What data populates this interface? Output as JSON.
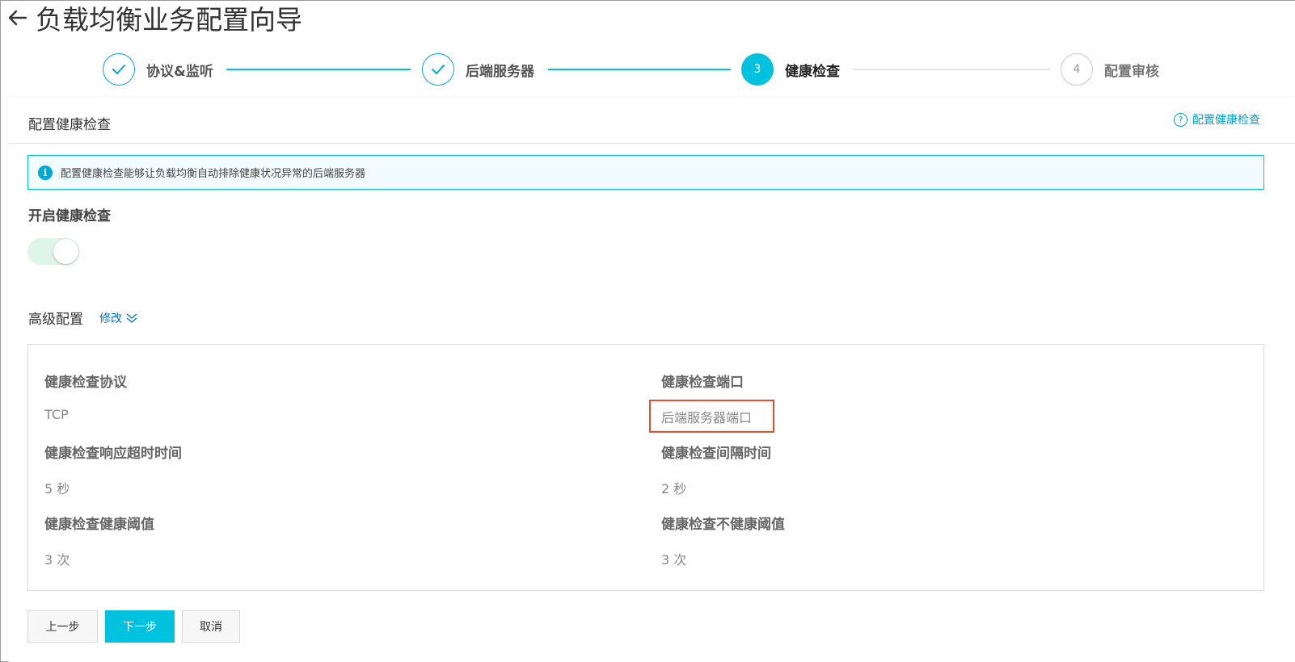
{
  "header": {
    "back_icon": "arrow-left-icon",
    "title": "负载均衡业务配置向导"
  },
  "steps": [
    {
      "label": "协议&监听",
      "status": "done",
      "marker": "✓"
    },
    {
      "label": "后端服务器",
      "status": "done",
      "marker": "✓"
    },
    {
      "label": "健康检查",
      "status": "active",
      "marker": "3"
    },
    {
      "label": "配置审核",
      "status": "todo",
      "marker": "4"
    }
  ],
  "card": {
    "title": "配置健康检查",
    "help_label": "配置健康检查",
    "help_icon": "question-circle-icon",
    "info_icon": "info-circle-icon",
    "info_text": "配置健康检查能够让负载均衡自动排除健康状况异常的后端服务器",
    "enable_label": "开启健康检查",
    "enable_on": true,
    "advanced_label": "高级配置",
    "modify_label": "修改"
  },
  "advanced": {
    "protocol_label": "健康检查协议",
    "protocol_value": "TCP",
    "port_label": "健康检查端口",
    "port_value": "后端服务器端口",
    "timeout_label": "健康检查响应超时时间",
    "timeout_value": "5 秒",
    "interval_label": "健康检查间隔时间",
    "interval_value": "2 秒",
    "healthy_label": "健康检查健康阈值",
    "healthy_value": "3 次",
    "unhealthy_label": "健康检查不健康阈值",
    "unhealthy_value": "3 次"
  },
  "buttons": {
    "prev": "上一步",
    "next": "下一步",
    "cancel": "取消"
  },
  "colors": {
    "accent": "#00c1de",
    "link": "#0073c9",
    "highlight": "#e5502e"
  }
}
